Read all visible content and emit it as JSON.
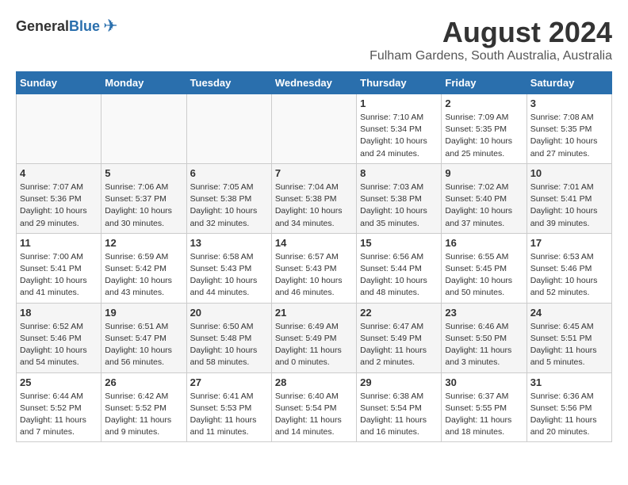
{
  "header": {
    "logo_general": "General",
    "logo_blue": "Blue",
    "month": "August 2024",
    "location": "Fulham Gardens, South Australia, Australia"
  },
  "weekdays": [
    "Sunday",
    "Monday",
    "Tuesday",
    "Wednesday",
    "Thursday",
    "Friday",
    "Saturday"
  ],
  "weeks": [
    [
      {
        "day": "",
        "info": ""
      },
      {
        "day": "",
        "info": ""
      },
      {
        "day": "",
        "info": ""
      },
      {
        "day": "",
        "info": ""
      },
      {
        "day": "1",
        "info": "Sunrise: 7:10 AM\nSunset: 5:34 PM\nDaylight: 10 hours\nand 24 minutes."
      },
      {
        "day": "2",
        "info": "Sunrise: 7:09 AM\nSunset: 5:35 PM\nDaylight: 10 hours\nand 25 minutes."
      },
      {
        "day": "3",
        "info": "Sunrise: 7:08 AM\nSunset: 5:35 PM\nDaylight: 10 hours\nand 27 minutes."
      }
    ],
    [
      {
        "day": "4",
        "info": "Sunrise: 7:07 AM\nSunset: 5:36 PM\nDaylight: 10 hours\nand 29 minutes."
      },
      {
        "day": "5",
        "info": "Sunrise: 7:06 AM\nSunset: 5:37 PM\nDaylight: 10 hours\nand 30 minutes."
      },
      {
        "day": "6",
        "info": "Sunrise: 7:05 AM\nSunset: 5:38 PM\nDaylight: 10 hours\nand 32 minutes."
      },
      {
        "day": "7",
        "info": "Sunrise: 7:04 AM\nSunset: 5:38 PM\nDaylight: 10 hours\nand 34 minutes."
      },
      {
        "day": "8",
        "info": "Sunrise: 7:03 AM\nSunset: 5:38 PM\nDaylight: 10 hours\nand 35 minutes."
      },
      {
        "day": "9",
        "info": "Sunrise: 7:02 AM\nSunset: 5:40 PM\nDaylight: 10 hours\nand 37 minutes."
      },
      {
        "day": "10",
        "info": "Sunrise: 7:01 AM\nSunset: 5:41 PM\nDaylight: 10 hours\nand 39 minutes."
      }
    ],
    [
      {
        "day": "11",
        "info": "Sunrise: 7:00 AM\nSunset: 5:41 PM\nDaylight: 10 hours\nand 41 minutes."
      },
      {
        "day": "12",
        "info": "Sunrise: 6:59 AM\nSunset: 5:42 PM\nDaylight: 10 hours\nand 43 minutes."
      },
      {
        "day": "13",
        "info": "Sunrise: 6:58 AM\nSunset: 5:43 PM\nDaylight: 10 hours\nand 44 minutes."
      },
      {
        "day": "14",
        "info": "Sunrise: 6:57 AM\nSunset: 5:43 PM\nDaylight: 10 hours\nand 46 minutes."
      },
      {
        "day": "15",
        "info": "Sunrise: 6:56 AM\nSunset: 5:44 PM\nDaylight: 10 hours\nand 48 minutes."
      },
      {
        "day": "16",
        "info": "Sunrise: 6:55 AM\nSunset: 5:45 PM\nDaylight: 10 hours\nand 50 minutes."
      },
      {
        "day": "17",
        "info": "Sunrise: 6:53 AM\nSunset: 5:46 PM\nDaylight: 10 hours\nand 52 minutes."
      }
    ],
    [
      {
        "day": "18",
        "info": "Sunrise: 6:52 AM\nSunset: 5:46 PM\nDaylight: 10 hours\nand 54 minutes."
      },
      {
        "day": "19",
        "info": "Sunrise: 6:51 AM\nSunset: 5:47 PM\nDaylight: 10 hours\nand 56 minutes."
      },
      {
        "day": "20",
        "info": "Sunrise: 6:50 AM\nSunset: 5:48 PM\nDaylight: 10 hours\nand 58 minutes."
      },
      {
        "day": "21",
        "info": "Sunrise: 6:49 AM\nSunset: 5:49 PM\nDaylight: 11 hours\nand 0 minutes."
      },
      {
        "day": "22",
        "info": "Sunrise: 6:47 AM\nSunset: 5:49 PM\nDaylight: 11 hours\nand 2 minutes."
      },
      {
        "day": "23",
        "info": "Sunrise: 6:46 AM\nSunset: 5:50 PM\nDaylight: 11 hours\nand 3 minutes."
      },
      {
        "day": "24",
        "info": "Sunrise: 6:45 AM\nSunset: 5:51 PM\nDaylight: 11 hours\nand 5 minutes."
      }
    ],
    [
      {
        "day": "25",
        "info": "Sunrise: 6:44 AM\nSunset: 5:52 PM\nDaylight: 11 hours\nand 7 minutes."
      },
      {
        "day": "26",
        "info": "Sunrise: 6:42 AM\nSunset: 5:52 PM\nDaylight: 11 hours\nand 9 minutes."
      },
      {
        "day": "27",
        "info": "Sunrise: 6:41 AM\nSunset: 5:53 PM\nDaylight: 11 hours\nand 11 minutes."
      },
      {
        "day": "28",
        "info": "Sunrise: 6:40 AM\nSunset: 5:54 PM\nDaylight: 11 hours\nand 14 minutes."
      },
      {
        "day": "29",
        "info": "Sunrise: 6:38 AM\nSunset: 5:54 PM\nDaylight: 11 hours\nand 16 minutes."
      },
      {
        "day": "30",
        "info": "Sunrise: 6:37 AM\nSunset: 5:55 PM\nDaylight: 11 hours\nand 18 minutes."
      },
      {
        "day": "31",
        "info": "Sunrise: 6:36 AM\nSunset: 5:56 PM\nDaylight: 11 hours\nand 20 minutes."
      }
    ]
  ]
}
